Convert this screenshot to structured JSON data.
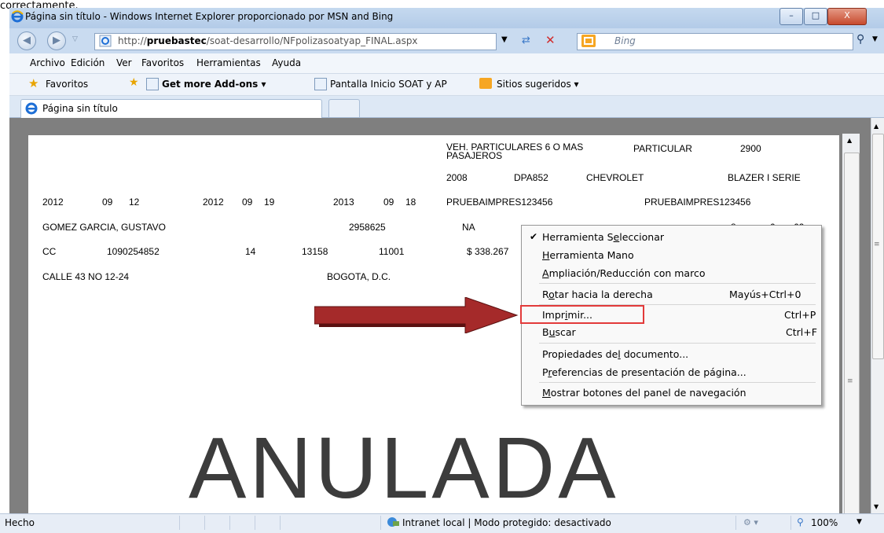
{
  "top_fragment": "correctamente.",
  "window": {
    "title": "Página sin título - Windows Internet Explorer proporcionado por MSN and Bing",
    "minimize": "–",
    "maximize": "□",
    "close": "X"
  },
  "address": {
    "url_prefix": "http://",
    "url_host": "pruebastec",
    "url_path": "/soat-desarrollo/NFpolizasoatyap_FINAL.aspx",
    "search_placeholder": "Bing"
  },
  "menu": [
    "Archivo",
    "Edición",
    "Ver",
    "Favoritos",
    "Herramientas",
    "Ayuda"
  ],
  "favorites": {
    "label": "Favoritos",
    "addons": "Get more Add-ons",
    "link1": "Pantalla Inicio SOAT y AP",
    "link2": "Sitios sugeridos"
  },
  "tab": {
    "title": "Página sin título"
  },
  "document": {
    "r0c0": "VEH. PARTICULARES 6 O MAS",
    "r0c0b": "PASAJEROS",
    "r0c1": "PARTICULAR",
    "r0c2": "2900",
    "r1c0": "2008",
    "r1c1": "DPA852",
    "r1c2": "CHEVROLET",
    "r1c3": "BLAZER I SERIE",
    "r2": [
      "2012",
      "09",
      "12",
      "2012",
      "09",
      "19",
      "2013",
      "09",
      "18",
      "PRUEBAIMPRES123456",
      "PRUEBAIMPRES123456"
    ],
    "r3": [
      "GOMEZ GARCIA, GUSTAVO",
      "2958625",
      "NA",
      "8",
      "0",
      "62"
    ],
    "r4": [
      "CC",
      "1090254852",
      "14",
      "13158",
      "11001",
      "$ 338.267"
    ],
    "r5": [
      "CALLE 43 NO 12-24",
      "BOGOTA, D.C."
    ],
    "watermark": "ANULADA"
  },
  "context_menu": {
    "items": [
      {
        "pre": "Herramienta S",
        "u": "e",
        "post": "leccionar",
        "shortcut": "",
        "checked": true
      },
      {
        "pre": "",
        "u": "H",
        "post": "erramienta Mano",
        "shortcut": ""
      },
      {
        "pre": "",
        "u": "A",
        "post": "mpliación/Reducción con marco",
        "shortcut": ""
      },
      {
        "pre": "R",
        "u": "o",
        "post": "tar hacia la derecha",
        "shortcut": "Mayús+Ctrl+0"
      },
      {
        "pre": "Impr",
        "u": "i",
        "post": "mir...",
        "shortcut": "Ctrl+P"
      },
      {
        "pre": "B",
        "u": "u",
        "post": "scar",
        "shortcut": "Ctrl+F"
      },
      {
        "pre": "Propiedades de",
        "u": "l",
        "post": " documento...",
        "shortcut": ""
      },
      {
        "pre": "P",
        "u": "r",
        "post": "eferencias de presentación de página...",
        "shortcut": ""
      },
      {
        "pre": "",
        "u": "M",
        "post": "ostrar botones del panel de navegación",
        "shortcut": ""
      }
    ]
  },
  "status": {
    "left": "Hecho",
    "zone": "Intranet local | Modo protegido: desactivado",
    "zoom": "100%"
  },
  "colors": {
    "titlebar": "#c5d9ef",
    "highlight_box": "#e23a3a",
    "arrow": "#a52a2a"
  }
}
